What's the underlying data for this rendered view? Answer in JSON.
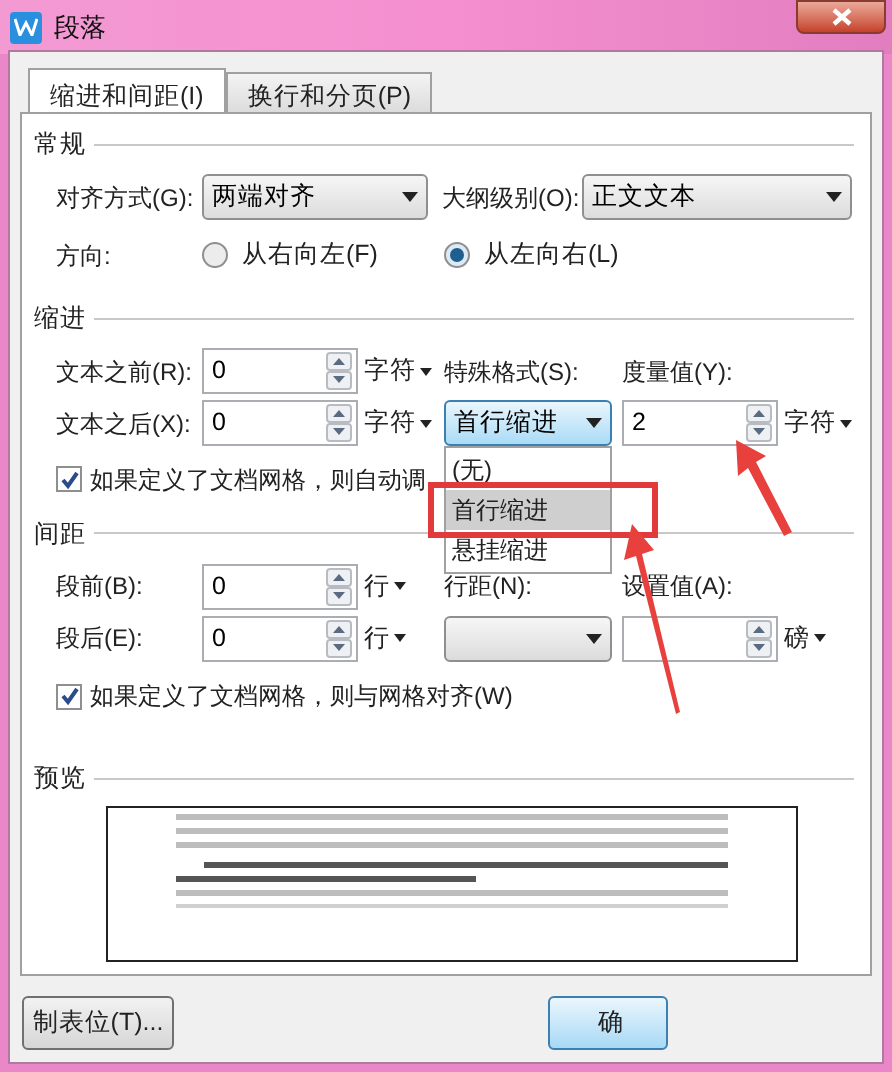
{
  "window": {
    "title": "段落"
  },
  "tabs": [
    {
      "label": "缩进和间距(I)",
      "selected": true
    },
    {
      "label": "换行和分页(P)",
      "selected": false
    }
  ],
  "general": {
    "heading": "常规",
    "alignment": {
      "label": "对齐方式(G):",
      "value": "两端对齐"
    },
    "outline_level": {
      "label": "大纲级别(O):",
      "value": "正文文本"
    },
    "direction": {
      "label": "方向:",
      "options": [
        {
          "label": "从右向左(F)",
          "selected": false
        },
        {
          "label": "从左向右(L)",
          "selected": true
        }
      ]
    }
  },
  "indent": {
    "heading": "缩进",
    "before": {
      "label": "文本之前(R):",
      "value": "0",
      "unit": "字符"
    },
    "after": {
      "label": "文本之后(X):",
      "value": "0",
      "unit": "字符"
    },
    "special": {
      "label": "特殊格式(S):",
      "value": "首行缩进"
    },
    "measure": {
      "label": "度量值(Y):",
      "value": "2",
      "unit": "字符"
    },
    "grid_check": {
      "label": "如果定义了文档网格，则自动调",
      "checked": true
    }
  },
  "dropdown_list": {
    "items": [
      {
        "label": "(无)",
        "selected": false
      },
      {
        "label": "首行缩进",
        "selected": true
      },
      {
        "label": "悬挂缩进",
        "selected": false
      }
    ]
  },
  "spacing": {
    "heading": "间距",
    "before": {
      "label": "段前(B):",
      "value": "0",
      "unit": "行"
    },
    "after": {
      "label": "段后(E):",
      "value": "0",
      "unit": "行"
    },
    "line_spacing": {
      "label": "行距(N):"
    },
    "setting": {
      "label": "设置值(A):",
      "unit": "磅"
    },
    "grid_check": {
      "label": "如果定义了文档网格，则与网格对齐(W)",
      "checked": true
    }
  },
  "preview": {
    "heading": "预览"
  },
  "buttons": [
    {
      "label": "制表位(T)..."
    },
    {
      "label": "确"
    }
  ]
}
